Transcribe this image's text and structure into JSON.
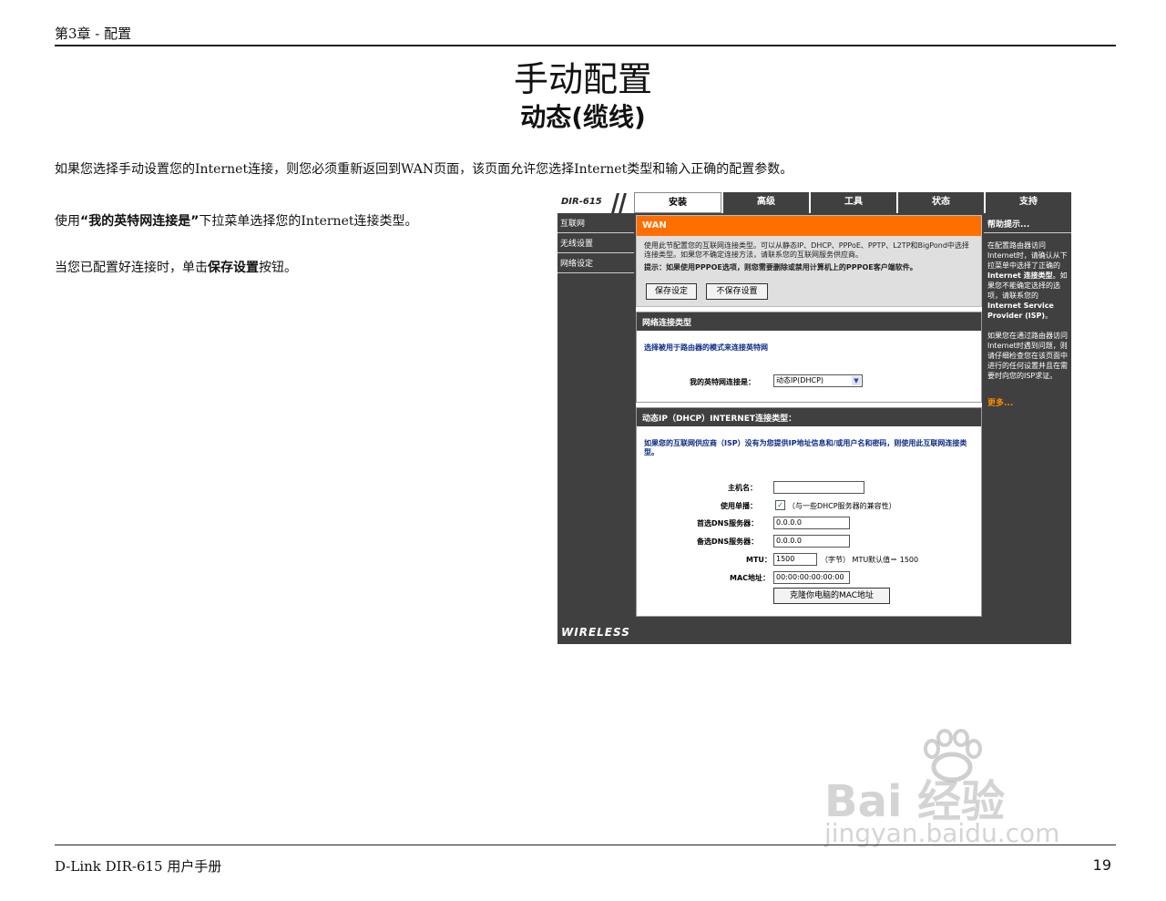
{
  "header": {
    "chapter": "第3章 - 配置"
  },
  "title": "手动配置",
  "subtitle": "动态(缆线)",
  "intro": "如果您选择手动设置您的Internet连接，则您必须重新返回到WAN页面，该页面允许您选择Internet类型和输入正确的配置参数。",
  "para1": {
    "pre": "使用",
    "bold": "“我的英特网连接是”",
    "post": "下拉菜单选择您的Internet连接类型。"
  },
  "para2": {
    "pre": "当您已配置好连接时，单击",
    "bold": "保存设置",
    "post": "按钮。"
  },
  "router": {
    "logo": "DIR-615",
    "tabs": [
      "安装",
      "高级",
      "工具",
      "状态",
      "支持"
    ],
    "active_tab_index": 0,
    "nav": [
      "互联网",
      "无线设置",
      "网络设定"
    ],
    "wan": {
      "title": "WAN",
      "desc": "使用此节配置您的互联网连接类型。可以从静态IP、DHCP、PPPoE、PPTP、L2TP和BigPond中选择连接类型。如果您不确定连接方法，请联系您的互联网服务供应商。",
      "hint": "提示：如果使用PPPOE选项，则您需要删除或禁用计算机上的PPPOE客户端软件。",
      "save": "保存设定",
      "dont_save": "不保存设置"
    },
    "conn_type": {
      "title": "网络连接类型",
      "desc": "选择被用于路由器的模式来连接英特网",
      "label": "我的英特网连接是：",
      "value": "动态IP(DHCP)"
    },
    "dhcp": {
      "title": "动态IP（DHCP）INTERNET连接类型：",
      "desc": "如果您的互联网供应商（ISP）没有为您提供IP地址信息和/或用户名和密码，则使用此互联网连接类型。",
      "host_label": "主机名：",
      "host_value": "",
      "unicast_label": "使用单播：",
      "unicast_note": "（与一些DHCP服务器的兼容性）",
      "dns1_label": "首选DNS服务器：",
      "dns1_value": "0.0.0.0",
      "dns2_label": "备选DNS服务器：",
      "dns2_value": "0.0.0.0",
      "mtu_label": "MTU：",
      "mtu_value": "1500",
      "mtu_note": "（字节） MTU默认值＝ 1500",
      "mac_label": "MAC地址：",
      "mac_value": "00:00:00:00:00:00",
      "clone_btn": "克隆你电脑的MAC地址"
    },
    "help": {
      "title": "帮助提示...",
      "text1": "在配置路由器访问Internet时，请确认从下拉菜单中选择了正确的",
      "bold1": "Internet 连接类型",
      "text2": "。如果您不能确定选择的选项，请联系您的",
      "bold2": "Internet Service Provider (ISP)",
      "text3": "。",
      "text4": "如果您在通过路由器访问Internet时遇到问题，则请仔细检查您在该页面中进行的任何设置并且在需要时向您的ISP求证。",
      "more": "更多..."
    },
    "footer": "WIRELESS"
  },
  "footer": {
    "left": "D-Link DIR-615 用户手册",
    "page": "19"
  },
  "watermark": {
    "brand": "Bai 经验",
    "site": "jingyan.baidu.com"
  }
}
